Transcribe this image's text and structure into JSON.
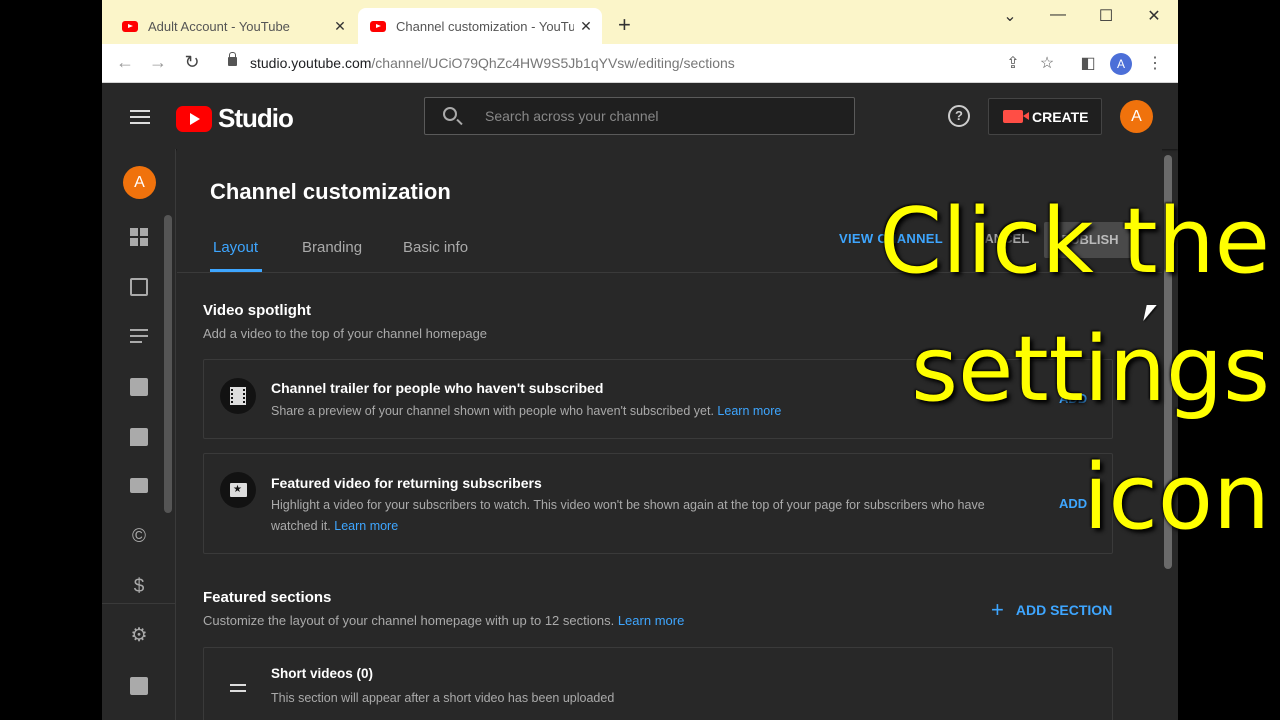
{
  "browser": {
    "tabs": [
      {
        "title": "Adult Account - YouTube",
        "close": "✕"
      },
      {
        "title": "Channel customization - YouTube",
        "close": "✕"
      }
    ],
    "new_tab": "+",
    "window_controls": {
      "minimize": "—",
      "maximize": "☐",
      "close": "✕",
      "menu": "⌄"
    },
    "url_host": "studio.youtube.com",
    "url_path": "/channel/UCiO79QhZc4HW9S5Jb1qYVsw/editing/sections",
    "profile_initial": "A"
  },
  "header": {
    "logo_text": "Studio",
    "search_placeholder": "Search across your channel",
    "help": "?",
    "create_label": "CREATE",
    "avatar_initial": "A"
  },
  "sidebar": {
    "avatar_initial": "A",
    "items": [
      "dashboard-icon",
      "content-icon",
      "playlists-icon",
      "analytics-icon",
      "comments-icon",
      "subtitles-icon",
      "copyright-icon",
      "earn-icon",
      "settings-icon",
      "feedback-icon"
    ]
  },
  "page": {
    "title": "Channel customization",
    "tabs": [
      "Layout",
      "Branding",
      "Basic info"
    ],
    "view_channel": "VIEW CHANNEL",
    "cancel": "CANCEL",
    "publish": "PUBLISH"
  },
  "video_spotlight": {
    "title": "Video spotlight",
    "desc": "Add a video to the top of your channel homepage",
    "cards": [
      {
        "title": "Channel trailer for people who haven't subscribed",
        "desc": "Share a preview of your channel shown with people who haven't subscribed yet.",
        "link": "Learn more",
        "action": "ADD"
      },
      {
        "title": "Featured video for returning subscribers",
        "desc_line1": "Highlight a video for your subscribers to watch. This video won't be shown again at the top of your page for subscribers who have",
        "desc_line2": "watched it.",
        "link": "Learn more",
        "action": "ADD"
      }
    ]
  },
  "featured_sections": {
    "title": "Featured sections",
    "desc": "Customize the layout of your channel homepage with up to 12 sections.",
    "link": "Learn more",
    "add_section": "ADD SECTION",
    "items": [
      {
        "title": "Short videos (0)",
        "desc": "This section will appear after a short video has been uploaded"
      }
    ]
  },
  "overlay": {
    "lines": [
      "Click the",
      "settings",
      "icon"
    ],
    "color": "#ffff00"
  },
  "colors": {
    "accent": "#3ea6ff",
    "brand_red": "#ff0000",
    "avatar": "#f0720c",
    "background": "#282828"
  }
}
